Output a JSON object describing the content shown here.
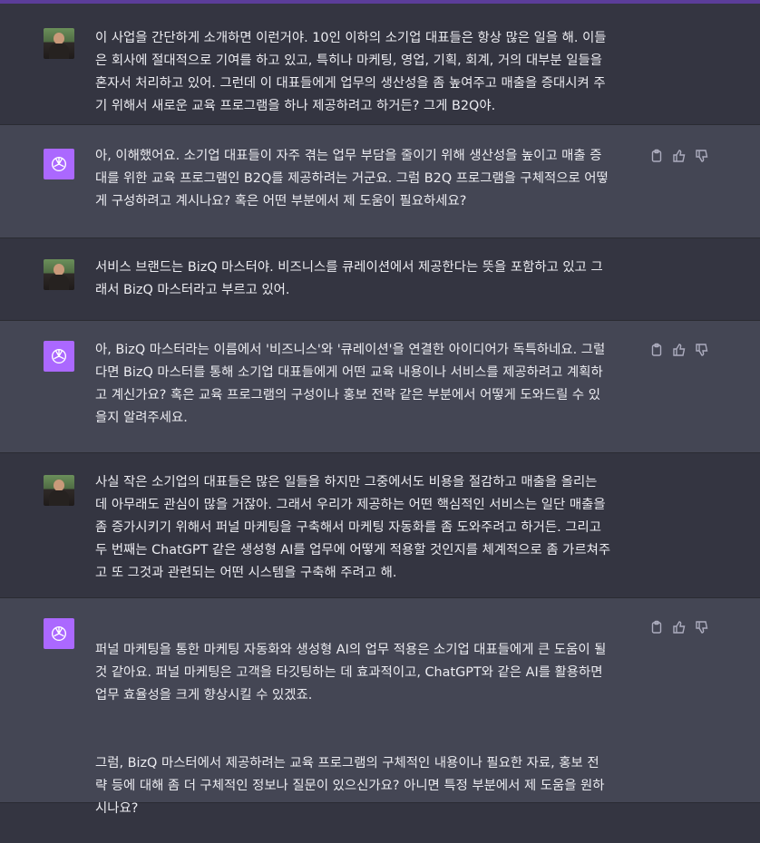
{
  "messages": [
    {
      "role": "user",
      "avatar": "user-photo-avatar",
      "text": "이 사업을 간단하게 소개하면 이런거야. 10인 이하의 소기업 대표들은 항상 많은 일을 해. 이들\n은 회사에 절대적으로 기여를 하고 있고, 특히나 마케팅, 영업, 기획, 회계, 거의 대부분 일들을\n혼자서 처리하고 있어. 그런데 이 대표들에게 업무의 생산성을 좀 높여주고 매출을 증대시켜 주\n기 위해서 새로운 교육 프로그램을 하나 제공하려고 하거든? 그게 B2Q야."
    },
    {
      "role": "assistant",
      "avatar": "openai-logo-icon",
      "text": "아, 이해했어요. 소기업 대표들이 자주 겪는 업무 부담을 줄이기 위해 생산성을 높이고 매출 증\n대를 위한 교육 프로그램인 B2Q를 제공하려는 거군요. 그럼 B2Q 프로그램을 구체적으로 어떻\n게 구성하려고 계시나요? 혹은 어떤 부분에서 제 도움이 필요하세요?"
    },
    {
      "role": "user",
      "avatar": "user-photo-avatar",
      "text": "서비스 브랜드는 BizQ 마스터야. 비즈니스를 큐레이션에서 제공한다는 뜻을 포함하고 있고 그\n래서 BizQ 마스터라고 부르고 있어."
    },
    {
      "role": "assistant",
      "avatar": "openai-logo-icon",
      "text": "아, BizQ 마스터라는 이름에서 '비즈니스'와 '큐레이션'을 연결한 아이디어가 독특하네요. 그럴\n다면 BizQ 마스터를 통해 소기업 대표들에게 어떤 교육 내용이나 서비스를 제공하려고 계획하\n고 계신가요? 혹은 교육 프로그램의 구성이나 홍보 전략 같은 부분에서 어떻게 도와드릴 수 있\n을지 알려주세요."
    },
    {
      "role": "user",
      "avatar": "user-photo-avatar",
      "text": "사실 작은 소기업의 대표들은 많은 일들을 하지만 그중에서도 비용을 절감하고 매출을 올리는\n데 아무래도 관심이 많을 거잖아. 그래서 우리가 제공하는 어떤 핵심적인 서비스는 일단 매출을\n좀 증가시키기 위해서 퍼널 마케팅을 구축해서 마케팅 자동화를 좀 도와주려고 하거든. 그리고\n두 번째는 ChatGPT 같은 생성형 AI를 업무에 어떻게 적용할 것인지를 체계적으로 좀 가르쳐주\n고 또 그것과 관련되는 어떤 시스템을 구축해 주려고 해."
    },
    {
      "role": "assistant",
      "avatar": "openai-logo-icon",
      "text": "퍼널 마케팅을 통한 마케팅 자동화와 생성형 AI의 업무 적용은 소기업 대표들에게 큰 도움이 될\n것 같아요. 퍼널 마케팅은 고객을 타깃팅하는 데 효과적이고, ChatGPT와 같은 AI를 활용하면\n업무 효율성을 크게 향상시킬 수 있겠죠.",
      "text2": "그럼, BizQ 마스터에서 제공하려는 교육 프로그램의 구체적인 내용이나 필요한 자료, 홍보 전\n략 등에 대해 좀 더 구체적인 정보나 질문이 있으신가요? 아니면 특정 부분에서 제 도움을 원하\n시나요?"
    }
  ],
  "action_icons": [
    "clipboard-icon",
    "thumbs-up-icon",
    "thumbs-down-icon"
  ],
  "colors": {
    "user_bg": "#343541",
    "assistant_bg": "#444654",
    "gpt_avatar": "#ab68ff",
    "top_accent": "#5b3d99"
  }
}
